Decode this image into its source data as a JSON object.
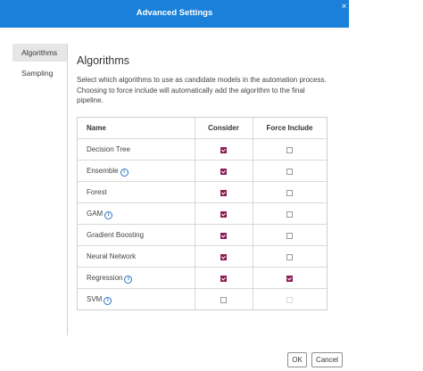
{
  "dialog": {
    "title": "Advanced Settings",
    "close_glyph": "×"
  },
  "sidebar": {
    "items": [
      {
        "label": "Algorithms",
        "active": true
      },
      {
        "label": "Sampling",
        "active": false
      }
    ]
  },
  "main": {
    "heading": "Algorithms",
    "description": "Select which algorithms to use as candidate models in the automation process. Choosing to force include will automatically add the algorithm to the final pipeline."
  },
  "table": {
    "headers": {
      "name": "Name",
      "consider": "Consider",
      "force": "Force Include"
    },
    "rows": [
      {
        "name": "Decision Tree",
        "info": false,
        "consider": true,
        "force": false,
        "force_enabled": true
      },
      {
        "name": "Ensemble",
        "info": true,
        "consider": true,
        "force": false,
        "force_enabled": true
      },
      {
        "name": "Forest",
        "info": false,
        "consider": true,
        "force": false,
        "force_enabled": true
      },
      {
        "name": "GAM",
        "info": true,
        "consider": true,
        "force": false,
        "force_enabled": true
      },
      {
        "name": "Gradient Boosting",
        "info": false,
        "consider": true,
        "force": false,
        "force_enabled": true
      },
      {
        "name": "Neural Network",
        "info": false,
        "consider": true,
        "force": false,
        "force_enabled": true
      },
      {
        "name": "Regression",
        "info": true,
        "consider": true,
        "force": true,
        "force_enabled": true
      },
      {
        "name": "SVM",
        "info": true,
        "consider": false,
        "force": false,
        "force_enabled": false
      }
    ]
  },
  "footer": {
    "ok_label": "OK",
    "cancel_label": "Cancel"
  },
  "icons": {
    "info": "info-circle-icon",
    "close": "close-icon",
    "checkbox": "checkbox-icon"
  },
  "colors": {
    "titlebar": "#1b80d9",
    "checkbox_checked": "#8b1d55",
    "info_icon": "#2a73c9"
  }
}
